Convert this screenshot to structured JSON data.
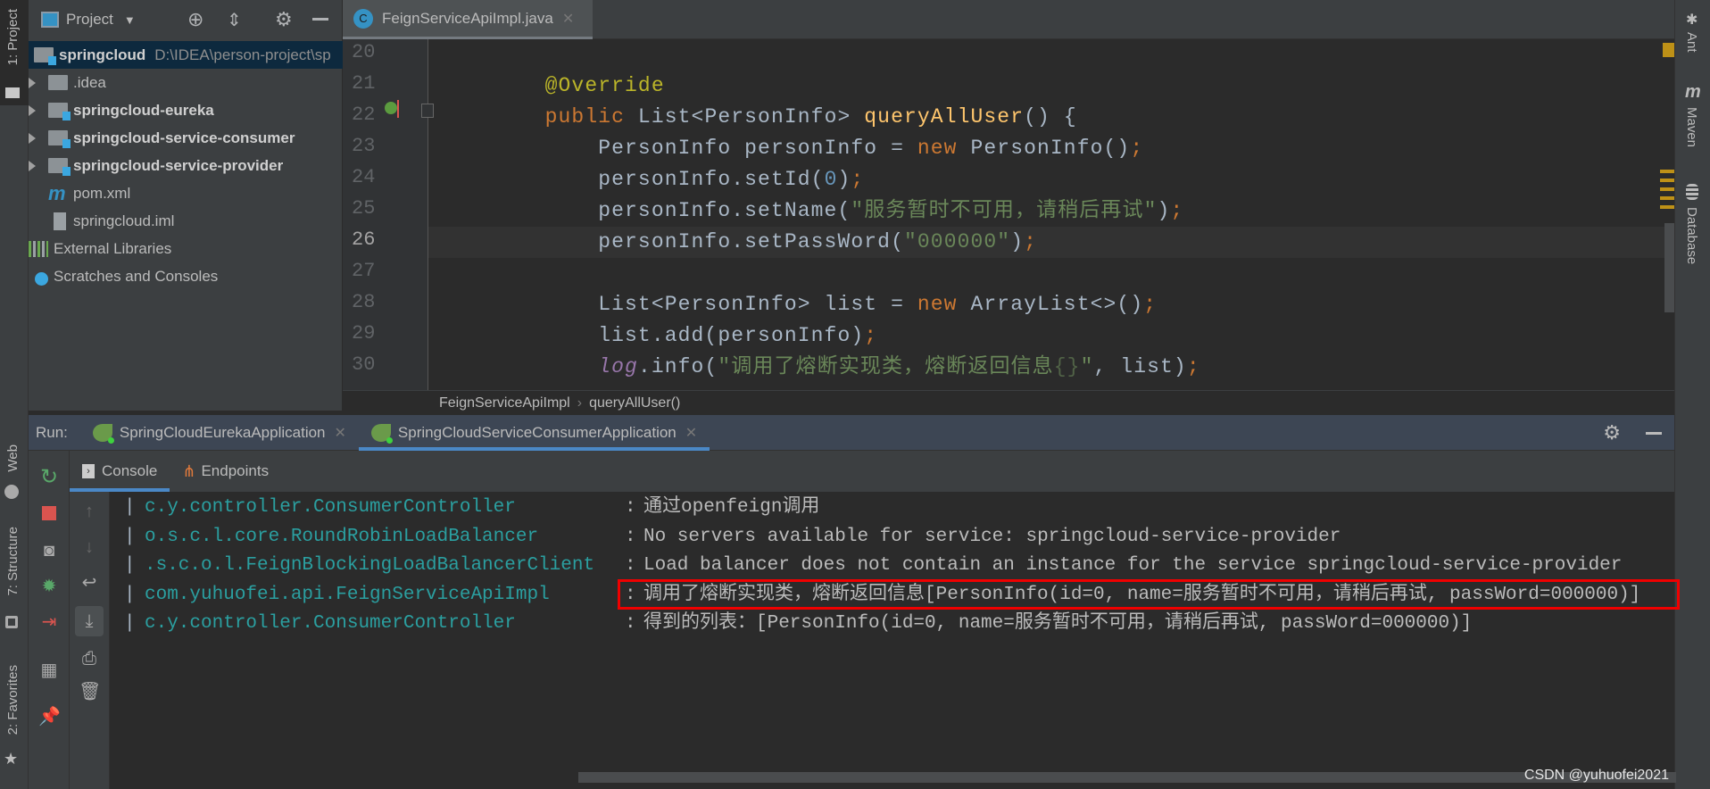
{
  "left_strip": {
    "project_tab": "1: Project",
    "web_tab": "Web",
    "structure_tab": "7: Structure",
    "favorites_tab": "2: Favorites"
  },
  "right_strip": {
    "ant": "Ant",
    "maven": "Maven",
    "database": "Database"
  },
  "project": {
    "title": "Project",
    "root": {
      "name": "springcloud",
      "path": "D:\\IDEA\\person-project\\sp"
    },
    "items": [
      {
        "label": ".idea",
        "icon": "folder-icon"
      },
      {
        "label": "springcloud-eureka",
        "icon": "module-icon"
      },
      {
        "label": "springcloud-service-consumer",
        "icon": "module-icon"
      },
      {
        "label": "springcloud-service-provider",
        "icon": "module-icon"
      },
      {
        "label": "pom.xml",
        "icon": "maven-icon"
      },
      {
        "label": "springcloud.iml",
        "icon": "iml-file-icon"
      }
    ],
    "external_libraries": "External Libraries",
    "scratches": "Scratches and Consoles"
  },
  "editor": {
    "tab": {
      "label": "FeignServiceApiImpl.java",
      "icon_letter": "C"
    },
    "current_line": 26,
    "lines": [
      {
        "n": "20",
        "tokens": []
      },
      {
        "n": "21",
        "tokens": [
          [
            "    @Override",
            "ann"
          ]
        ]
      },
      {
        "n": "22",
        "tokens": [
          [
            "    ",
            ""
          ],
          [
            "public",
            "kw"
          ],
          [
            " List<PersonInfo> ",
            ""
          ],
          [
            "queryAllUser",
            "fn"
          ],
          [
            "() {",
            ""
          ]
        ]
      },
      {
        "n": "23",
        "tokens": [
          [
            "        PersonInfo personInfo = ",
            ""
          ],
          [
            "new",
            "kw"
          ],
          [
            " PersonInfo()",
            ""
          ],
          [
            ";",
            "semi"
          ]
        ]
      },
      {
        "n": "24",
        "tokens": [
          [
            "        personInfo.setId(",
            ""
          ],
          [
            "0",
            "num"
          ],
          [
            ")",
            ""
          ],
          [
            ";",
            "semi"
          ]
        ]
      },
      {
        "n": "25",
        "tokens": [
          [
            "        personInfo.setName(",
            ""
          ],
          [
            "\"服务暂时不可用，请稍后再试\"",
            "str"
          ],
          [
            ")",
            ""
          ],
          [
            ";",
            "semi"
          ]
        ]
      },
      {
        "n": "26",
        "tokens": [
          [
            "        personInfo.setPassWord(",
            ""
          ],
          [
            "\"000000\"",
            "str"
          ],
          [
            ")",
            ""
          ],
          [
            ";",
            "semi"
          ]
        ]
      },
      {
        "n": "27",
        "tokens": []
      },
      {
        "n": "28",
        "tokens": [
          [
            "        List<PersonInfo> list = ",
            ""
          ],
          [
            "new",
            "kw"
          ],
          [
            " ArrayList<>()",
            ""
          ],
          [
            ";",
            "semi"
          ]
        ]
      },
      {
        "n": "29",
        "tokens": [
          [
            "        list.add(personInfo)",
            ""
          ],
          [
            ";",
            "semi"
          ]
        ]
      },
      {
        "n": "30",
        "tokens": [
          [
            "        ",
            ""
          ],
          [
            "log",
            "log"
          ],
          [
            ".info(",
            ""
          ],
          [
            "\"调用了熔断实现类，熔断返回信息",
            "str"
          ],
          [
            "{}",
            "fmt"
          ],
          [
            "\"",
            "str"
          ],
          [
            ", list)",
            ""
          ],
          [
            ";",
            "semi"
          ]
        ]
      }
    ],
    "breadcrumb": [
      "FeignServiceApiImpl",
      "queryAllUser()"
    ]
  },
  "run": {
    "label": "Run:",
    "tabs": [
      {
        "label": "SpringCloudEurekaApplication",
        "active": false
      },
      {
        "label": "SpringCloudServiceConsumerApplication",
        "active": true
      }
    ],
    "subtabs": [
      {
        "label": "Console",
        "active": true
      },
      {
        "label": "Endpoints",
        "active": false
      }
    ],
    "console_lines": [
      {
        "sep": "|",
        "logger": "c.y.controller.ConsumerController",
        "colon": ":",
        "msg": "通过openfeign调用"
      },
      {
        "sep": "|",
        "logger": "o.s.c.l.core.RoundRobinLoadBalancer",
        "colon": ":",
        "msg": "No servers available for service: springcloud-service-provider"
      },
      {
        "sep": "|",
        "logger": ".s.c.o.l.FeignBlockingLoadBalancerClient",
        "colon": ":",
        "msg": "Load balancer does not contain an instance for the service springcloud-service-provider"
      },
      {
        "sep": "|",
        "logger": "com.yuhuofei.api.FeignServiceApiImpl",
        "colon": ":",
        "msg": "调用了熔断实现类，熔断返回信息[PersonInfo(id=0, name=服务暂时不可用，请稍后再试, passWord=000000)]"
      },
      {
        "sep": "|",
        "logger": "c.y.controller.ConsumerController",
        "colon": ":",
        "msg": "得到的列表：[PersonInfo(id=0, name=服务暂时不可用，请稍后再试, passWord=000000)]"
      }
    ],
    "highlight_color": "#f00000"
  },
  "watermark": "CSDN @yuhuofei2021"
}
